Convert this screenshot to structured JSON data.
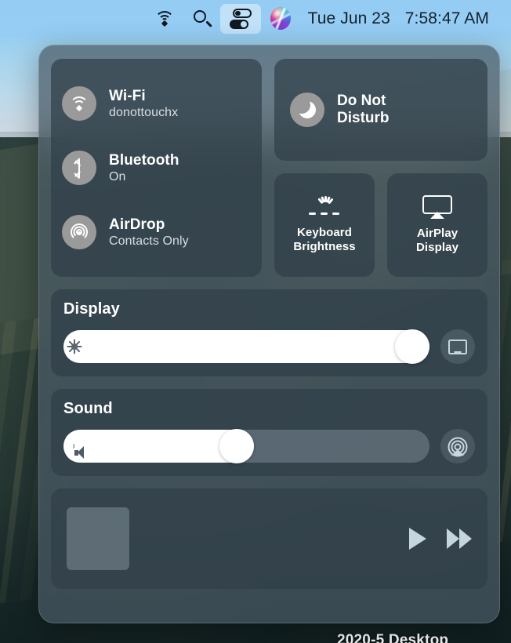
{
  "menubar": {
    "wifi_icon": "wifi-icon",
    "search_icon": "search-icon",
    "control_center_icon": "control-center-icon",
    "siri_icon": "siri-icon",
    "date": "Tue Jun 23",
    "time": "7:58:47 AM"
  },
  "desktop": {
    "icon_label": "2020-5 Desktop"
  },
  "control_center": {
    "connectivity": {
      "items": [
        {
          "icon": "wifi-icon",
          "title": "Wi-Fi",
          "status": "donottouchx"
        },
        {
          "icon": "bluetooth-icon",
          "title": "Bluetooth",
          "status": "On"
        },
        {
          "icon": "airdrop-icon",
          "title": "AirDrop",
          "status": "Contacts Only"
        }
      ]
    },
    "do_not_disturb": {
      "icon": "moon-icon",
      "label_line1": "Do Not",
      "label_line2": "Disturb"
    },
    "tiles": [
      {
        "icon": "keyboard-brightness-icon",
        "label_line1": "Keyboard",
        "label_line2": "Brightness"
      },
      {
        "icon": "airplay-display-icon",
        "label_line1": "AirPlay",
        "label_line2": "Display"
      }
    ],
    "display": {
      "title": "Display",
      "slider_icon": "brightness-sun-icon",
      "slider_value": 100,
      "action_icon": "display-mirror-icon"
    },
    "sound": {
      "title": "Sound",
      "slider_icon": "speaker-volume-icon",
      "slider_value": 47,
      "action_icon": "airplay-audio-icon"
    },
    "media": {
      "artwork": "album-artwork-placeholder",
      "play_icon": "play-icon",
      "forward_icon": "fast-forward-icon"
    }
  },
  "colors": {
    "menubar_bg": "#96cdf5",
    "panel_bg": "#4a5a65",
    "module_bg": "#303e48",
    "icon_circle": "#9a9a9a",
    "slider_fill": "#ffffff",
    "text_primary": "#ffffff",
    "text_secondary": "#d7dde2",
    "control_icon": "#c5d6de"
  }
}
